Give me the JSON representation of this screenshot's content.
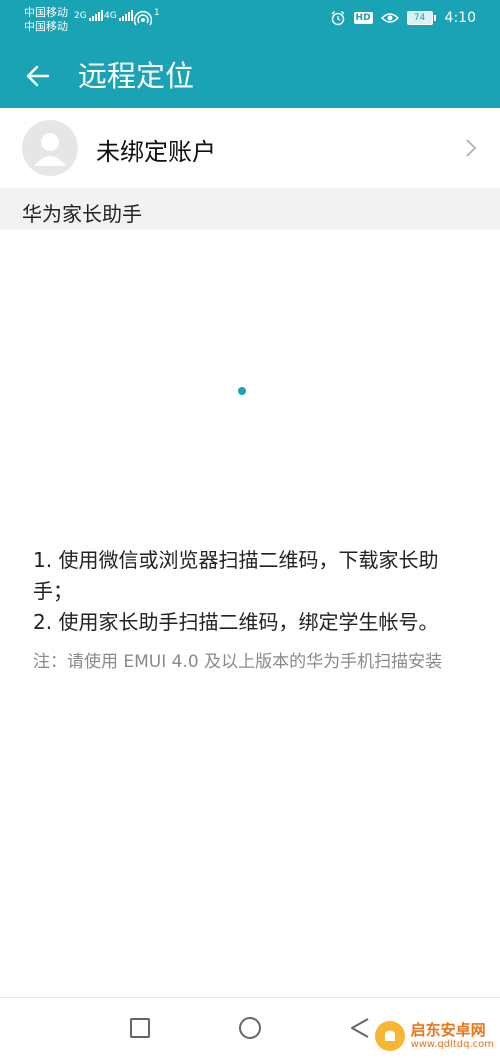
{
  "status_bar": {
    "carrier_1": "中国移动",
    "carrier_2": "中国移动",
    "net_1": "2G",
    "net_2": "4G",
    "hotspot_count": "1",
    "hd": "HD",
    "battery": "74",
    "time": "4:10",
    "icons": [
      "signal-icon",
      "hotspot-icon",
      "alarm-icon",
      "hd-icon",
      "eye-icon",
      "battery-icon"
    ]
  },
  "header": {
    "title": "远程定位",
    "back_icon": "arrow-left-icon"
  },
  "account": {
    "label": "未绑定账户",
    "avatar_icon": "user-avatar-icon",
    "chevron_icon": "chevron-right-icon"
  },
  "section": {
    "title": "华为家长助手"
  },
  "instructions": {
    "step1": "1. 使用微信或浏览器扫描二维码，下载家长助手；",
    "step2": "2. 使用家长助手扫描二维码，绑定学生帐号。",
    "note": "注：请使用 EMUI 4.0 及以上版本的华为手机扫描安装"
  },
  "nav_bar": {
    "icons": [
      "recents-square-icon",
      "home-circle-icon",
      "back-triangle-icon"
    ]
  },
  "watermark": {
    "name": "启东安卓网",
    "url": "www.qdltdq.com"
  },
  "colors": {
    "primary": "#1aa3b5",
    "section_bg": "#f2f2f2",
    "note_text": "#8a8a8a"
  }
}
